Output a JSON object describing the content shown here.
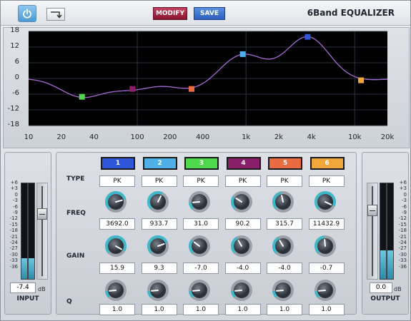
{
  "toolbar": {
    "title": "6Band EQUALIZER",
    "modify_label": "MODIFY",
    "save_label": "SAVE",
    "power_icon": "power-icon",
    "mode_icon": "route-icon"
  },
  "graph": {
    "y_ticks": [
      "18",
      "12",
      "6",
      "0",
      "-6",
      "-12",
      "-18"
    ],
    "x_ticks": [
      "10",
      "20",
      "40",
      "100",
      "200",
      "400",
      "1k",
      "2k",
      "4k",
      "10k",
      "20k"
    ]
  },
  "input": {
    "label": "INPUT",
    "value": "-7.4",
    "unit": "dB",
    "level": 0.22,
    "scale": [
      "+6",
      "+3",
      "0",
      "-3",
      "-6",
      "-9",
      "-12",
      "-15",
      "-18",
      "-21",
      "-24",
      "-27",
      "-30",
      "-33",
      "-36"
    ]
  },
  "output": {
    "label": "OUTPUT",
    "value": "0.0",
    "unit": "dB",
    "level": 0.3,
    "scale": [
      "+6",
      "+3",
      "0",
      "-3",
      "-6",
      "-9",
      "-12",
      "-15",
      "-18",
      "-21",
      "-24",
      "-27",
      "-30",
      "-33",
      "-36"
    ]
  },
  "rows": {
    "type": "TYPE",
    "freq": "FREQ",
    "gain": "GAIN",
    "q": "Q"
  },
  "bands": [
    {
      "label": "1",
      "color": "#2f55d8",
      "type": "PK",
      "freq": "3692.0",
      "gain": "15.9",
      "q": "1.0"
    },
    {
      "label": "2",
      "color": "#4fb0e8",
      "type": "PK",
      "freq": "933.7",
      "gain": "9.3",
      "q": "1.0"
    },
    {
      "label": "3",
      "color": "#4fd84b",
      "type": "PK",
      "freq": "31.0",
      "gain": "-7.0",
      "q": "1.0"
    },
    {
      "label": "4",
      "color": "#8a1e6a",
      "type": "PK",
      "freq": "90.2",
      "gain": "-4.0",
      "q": "1.0"
    },
    {
      "label": "5",
      "color": "#ea6a42",
      "type": "PK",
      "freq": "315.7",
      "gain": "-4.0",
      "q": "1.0"
    },
    {
      "label": "6",
      "color": "#f0a63a",
      "type": "PK",
      "freq": "11432.9",
      "gain": "-0.7",
      "q": "1.0"
    }
  ]
}
